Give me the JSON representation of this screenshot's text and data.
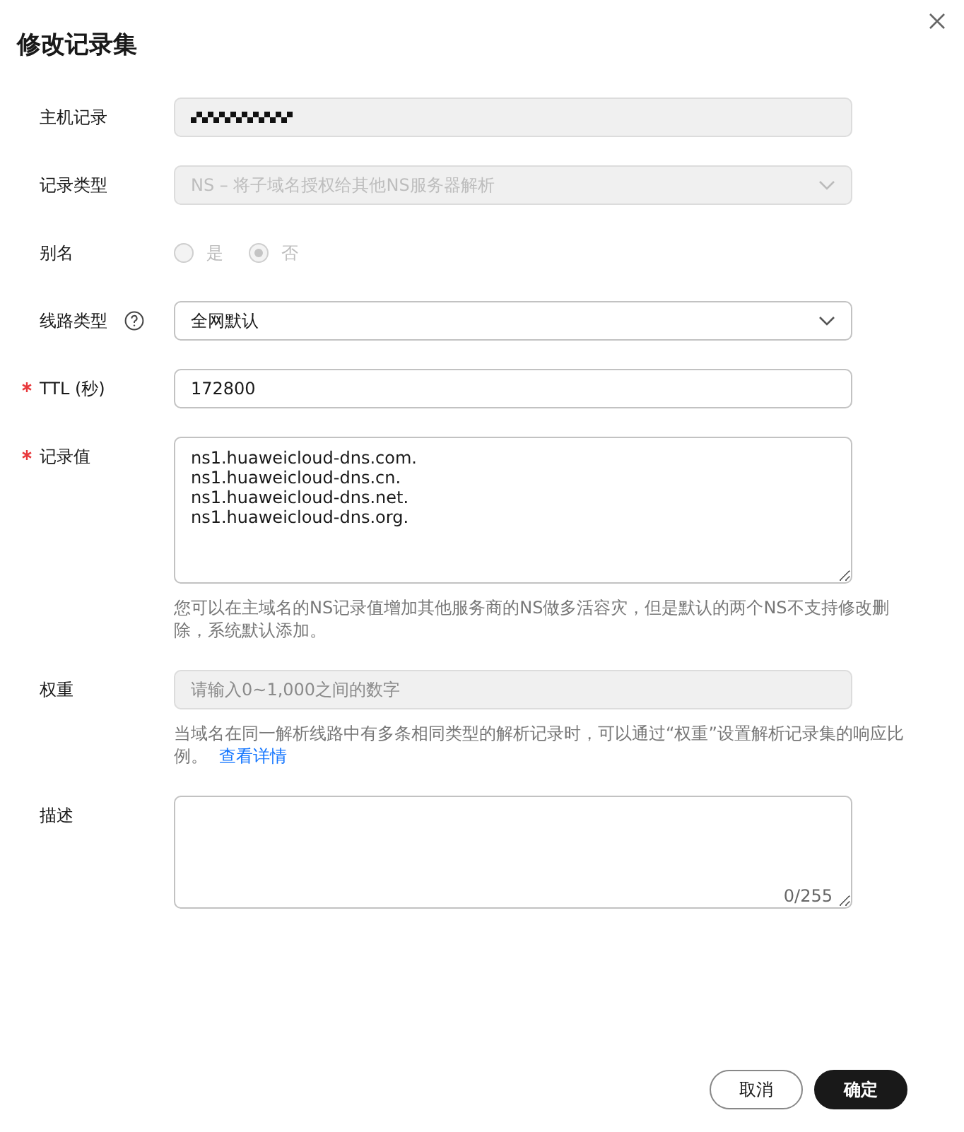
{
  "dialog": {
    "title": "修改记录集"
  },
  "fields": [
    {
      "kind": "masked",
      "label": "主机记录",
      "required": false,
      "disabled": true
    },
    {
      "kind": "select",
      "label": "记录类型",
      "required": false,
      "disabled": true,
      "value": "NS – 将子域名授权给其他NS服务器解析"
    },
    {
      "kind": "radio",
      "label": "别名",
      "required": false,
      "disabled": true,
      "options": [
        {
          "label": "是",
          "selected": false
        },
        {
          "label": "否",
          "selected": true
        }
      ]
    },
    {
      "kind": "select",
      "label": "线路类型",
      "help": true,
      "required": false,
      "disabled": false,
      "value": "全网默认"
    },
    {
      "kind": "input",
      "label": "TTL (秒)",
      "required": true,
      "disabled": false,
      "value": "172800"
    },
    {
      "kind": "textarea",
      "label": "记录值",
      "required": true,
      "disabled": false,
      "value": "ns1.huaweicloud-dns.com.\nns1.huaweicloud-dns.cn.\nns1.huaweicloud-dns.net.\nns1.huaweicloud-dns.org.",
      "hint": {
        "text": "您可以在主域名的NS记录值增加其他服务商的NS做多活容灾，但是默认的两个NS不支持修改删除，系统默认添加。"
      }
    },
    {
      "kind": "input",
      "label": "权重",
      "required": false,
      "disabled": true,
      "placeholder": "请输入0~1,000之间的数字",
      "hint": {
        "text": "当域名在同一解析线路中有多条相同类型的解析记录时，可以通过“权重”设置解析记录集的响应比例。",
        "link": "查看详情"
      }
    },
    {
      "kind": "textarea",
      "label": "描述",
      "required": false,
      "disabled": false,
      "counter": "0/255"
    }
  ],
  "buttons": [
    {
      "label": "取消",
      "kind": "secondary"
    },
    {
      "label": "确定",
      "kind": "primary"
    }
  ]
}
